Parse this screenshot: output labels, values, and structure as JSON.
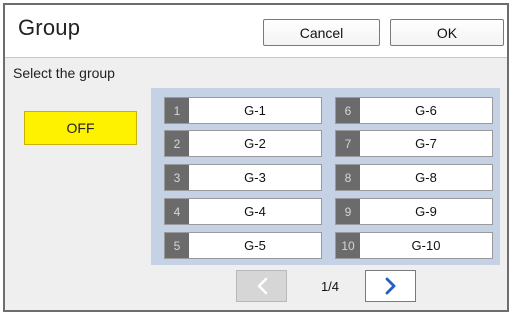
{
  "header": {
    "title": "Group",
    "cancel_label": "Cancel",
    "ok_label": "OK"
  },
  "subtitle": "Select the group",
  "off_label": "OFF",
  "groups": [
    {
      "num": "1",
      "name": "G-1"
    },
    {
      "num": "2",
      "name": "G-2"
    },
    {
      "num": "3",
      "name": "G-3"
    },
    {
      "num": "4",
      "name": "G-4"
    },
    {
      "num": "5",
      "name": "G-5"
    },
    {
      "num": "6",
      "name": "G-6"
    },
    {
      "num": "7",
      "name": "G-7"
    },
    {
      "num": "8",
      "name": "G-8"
    },
    {
      "num": "9",
      "name": "G-9"
    },
    {
      "num": "10",
      "name": "G-10"
    }
  ],
  "pagination": {
    "page_label": "1/4",
    "prev_icon": "chevron-left-icon",
    "next_icon": "chevron-right-icon"
  },
  "colors": {
    "off_button": "#fff200",
    "panel": "#c5d2e6",
    "number_tab": "#6b6b6b",
    "next_arrow": "#1f5fc9"
  }
}
